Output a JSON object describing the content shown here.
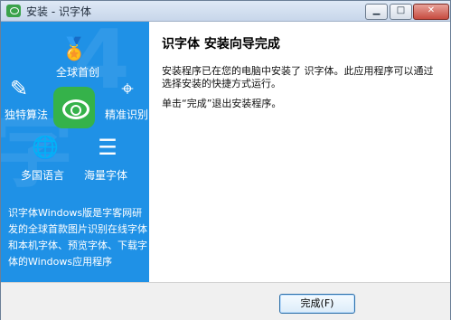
{
  "window": {
    "title": "安装 - 识字体",
    "min_symbol": "▁",
    "max_symbol": "□",
    "close_symbol": "✕"
  },
  "left_panel": {
    "features": [
      {
        "label": "全球首创",
        "icon": "medal-icon"
      },
      {
        "label": "独特算法",
        "icon": "pencil-ruler-icon"
      },
      {
        "label": "精准识别",
        "icon": "target-icon"
      },
      {
        "label": "多国语言",
        "icon": "globe-search-icon"
      },
      {
        "label": "海量字体",
        "icon": "stack-icon"
      }
    ],
    "description": "识字体Windows版是字客网研发的全球首款图片识别在线字体和本机字体、预览字体、下载字体的Windows应用程序"
  },
  "main": {
    "heading": "识字体 安装向导完成",
    "message1": "安装程序已在您的电脑中安装了 识字体。此应用程序可以通过选择安装的快捷方式运行。",
    "message2": "单击“完成”退出安装程序。"
  },
  "footer": {
    "finish_label": "完成(F)"
  },
  "colors": {
    "left_panel_blue": "#1f91e6",
    "center_green": "#35b24a"
  }
}
